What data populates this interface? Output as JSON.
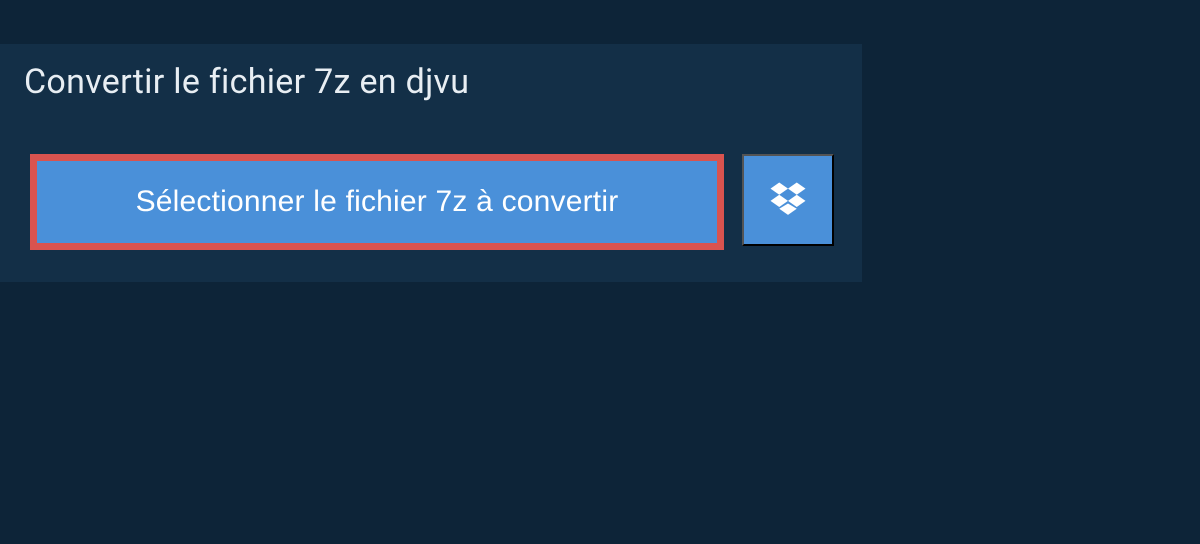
{
  "header": {
    "title": "Convertir le fichier 7z en djvu"
  },
  "actions": {
    "select_file_label": "Sélectionner le fichier 7z à convertir"
  },
  "colors": {
    "background": "#0d2438",
    "panel": "#132f47",
    "button_primary": "#4a90d9",
    "button_border_highlight": "#d9534f",
    "text_light": "#e8eef3",
    "text_white": "#ffffff"
  }
}
